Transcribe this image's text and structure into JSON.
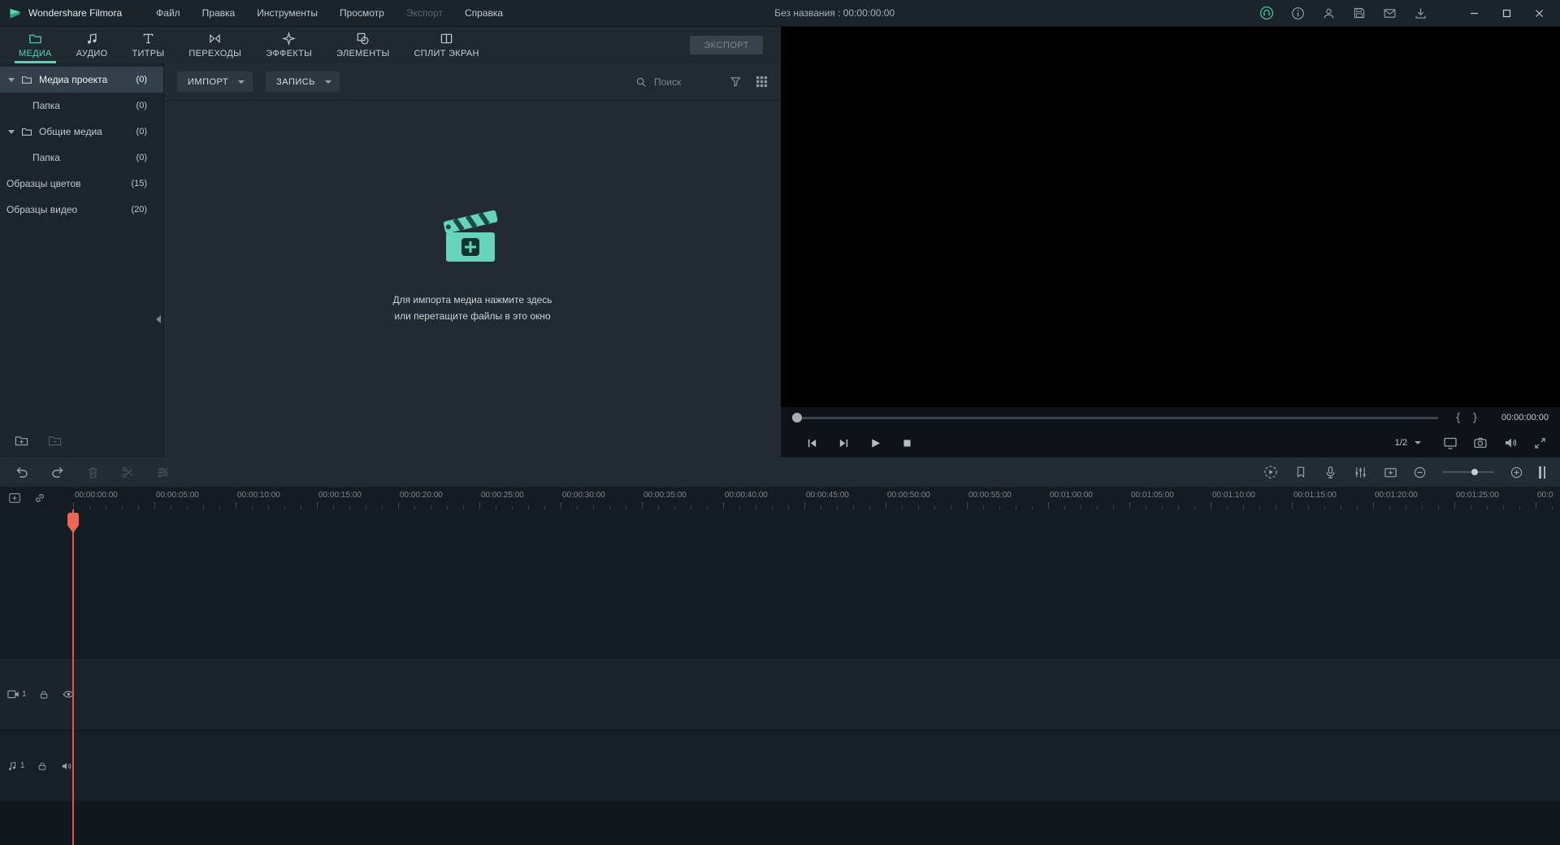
{
  "titlebar": {
    "app_name": "Wondershare Filmora",
    "menus": [
      "Файл",
      "Правка",
      "Инструменты",
      "Просмотр",
      "Экспорт",
      "Справка"
    ],
    "project_title": "Без названия : 00:00:00:00"
  },
  "tabbar": {
    "tabs": [
      {
        "label": "МЕДИА",
        "icon": "folder-icon"
      },
      {
        "label": "АУДИО",
        "icon": "music-note-icon"
      },
      {
        "label": "ТИТРЫ",
        "icon": "titles-icon"
      },
      {
        "label": "ПЕРЕХОДЫ",
        "icon": "transitions-icon"
      },
      {
        "label": "ЭФФЕКТЫ",
        "icon": "effects-icon"
      },
      {
        "label": "ЭЛЕМЕНТЫ",
        "icon": "elements-icon"
      },
      {
        "label": "СПЛИТ ЭКРАН",
        "icon": "split-screen-icon"
      }
    ],
    "export_button": "ЭКСПОРТ"
  },
  "sidebar": {
    "items": [
      {
        "label": "Медиа проекта",
        "count": "(0)"
      },
      {
        "label": "Папка",
        "count": "(0)"
      },
      {
        "label": "Общие медиа",
        "count": "(0)"
      },
      {
        "label": "Папка",
        "count": "(0)"
      },
      {
        "label": "Образцы цветов",
        "count": "(15)"
      },
      {
        "label": "Образцы видео",
        "count": "(20)"
      }
    ]
  },
  "media_panel": {
    "import_button": "ИМПОРТ",
    "record_button": "ЗАПИСЬ",
    "search_placeholder": "Поиск",
    "empty_state_line1": "Для импорта медиа нажмите здесь",
    "empty_state_line2": "или перетащите файлы в это окно"
  },
  "preview": {
    "timecode": "00:00:00:00",
    "mark_in": "{",
    "mark_out": "}",
    "zoom_select": "1/2"
  },
  "timeline": {
    "ruler_ticks": [
      "00:00:00:00",
      "00:00:05:00",
      "00:00:10:00",
      "00:00:15:00",
      "00:00:20:00",
      "00:00:25:00",
      "00:00:30:00",
      "00:00:35:00",
      "00:00:40:00",
      "00:00:45:00",
      "00:00:50:00",
      "00:00:55:00",
      "00:01:00:00",
      "00:01:05:00",
      "00:01:10:00",
      "00:01:15:00",
      "00:01:20:00",
      "00:01:25:00",
      "00:0"
    ],
    "video_track_number": "1",
    "audio_track_number": "1"
  },
  "colors": {
    "accent_teal": "#5ad1b8",
    "playhead_red": "#e8604f"
  }
}
